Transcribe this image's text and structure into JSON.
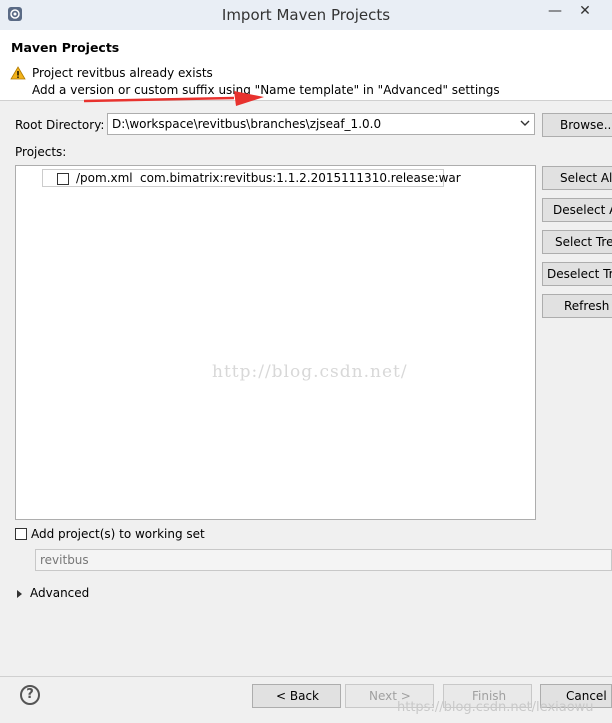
{
  "window": {
    "title": "Import Maven Projects",
    "minimize_glyph": "—",
    "close_glyph": "✕"
  },
  "header": {
    "title": "Maven Projects",
    "warning_line1": "Project revitbus already exists",
    "warning_line2": "Add a version or custom suffix using \"Name template\" in \"Advanced\" settings"
  },
  "root": {
    "label": "Root Directory:",
    "value": "D:\\workspace\\revitbus\\branches\\zjseaf_1.0.0",
    "browse_label": "Browse..."
  },
  "projects": {
    "label": "Projects:",
    "items": [
      {
        "pom": "/pom.xml",
        "coordinates": "com.bimatrix:revitbus:1.1.2.2015111310.release:war",
        "checked": false
      }
    ]
  },
  "side_buttons": {
    "select_all": "Select All",
    "deselect_all": "Deselect All",
    "select_tree": "Select Tree",
    "deselect_tree": "Deselect Tree",
    "refresh": "Refresh"
  },
  "working_set": {
    "checkbox_label": "Add project(s) to working set",
    "value": "revitbus"
  },
  "advanced": {
    "label": "Advanced"
  },
  "footer": {
    "help_glyph": "?",
    "back_label": "< Back",
    "next_label": "Next >",
    "finish_label": "Finish",
    "cancel_label": "Cancel"
  },
  "watermarks": {
    "center": "http://blog.csdn.net/",
    "footer": "https://blog.csdn.net/lexiaowu"
  },
  "colors": {
    "arrow": "#e8322e",
    "warning": "#f2b21a",
    "selection_border": "#adadad"
  }
}
